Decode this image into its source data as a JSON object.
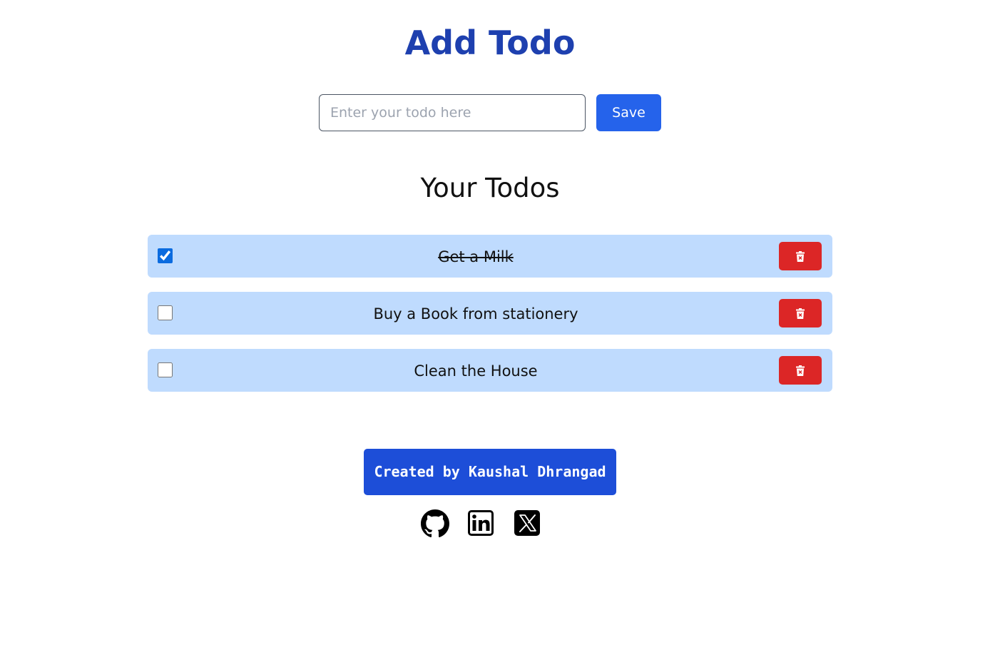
{
  "header": {
    "title": "Add Todo"
  },
  "form": {
    "input_value": "",
    "input_placeholder": "Enter your todo here",
    "save_label": "Save"
  },
  "list": {
    "title": "Your Todos",
    "items": [
      {
        "text": "Get a Milk",
        "completed": true
      },
      {
        "text": "Buy a Book from stationery",
        "completed": false
      },
      {
        "text": "Clean the House",
        "completed": false
      }
    ]
  },
  "footer": {
    "credit": "Created by Kaushal Dhrangad",
    "socials": [
      "github-icon",
      "linkedin-icon",
      "x-icon"
    ]
  },
  "colors": {
    "title": "#1e40af",
    "save_button": "#2563eb",
    "todo_row": "#bfdbfe",
    "delete_button": "#dc2626",
    "credit_banner": "#1d4ed8"
  }
}
